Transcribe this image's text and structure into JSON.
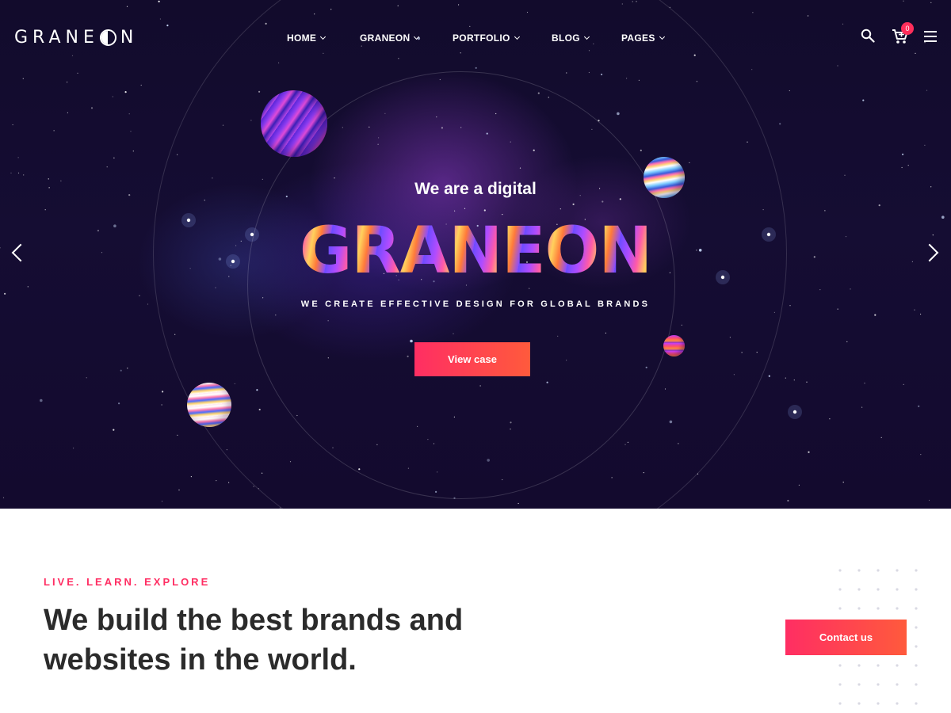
{
  "header": {
    "logo_before": "GRANE",
    "logo_after": "N",
    "nav": [
      {
        "label": "HOME"
      },
      {
        "label": "GRANEON"
      },
      {
        "label": "PORTFOLIO"
      },
      {
        "label": "BLOG"
      },
      {
        "label": "PAGES"
      }
    ],
    "cart_count": "0",
    "icons": [
      "search-icon",
      "cart-icon",
      "menu-icon",
      "chevron-down-icon"
    ]
  },
  "hero": {
    "kicker": "We are a digital",
    "title": "GRANEON",
    "subtitle": "WE CREATE EFFECTIVE DESIGN FOR GLOBAL BRANDS",
    "cta_label": "View case",
    "icons": [
      "chevron-left-icon",
      "chevron-right-icon"
    ]
  },
  "intro": {
    "eyebrow": "LIVE. LEARN. EXPLORE",
    "headline_line1": "We build the best brands and",
    "headline_line2": "websites in the world.",
    "cta_label": "Contact us"
  },
  "colors": {
    "accent": "#ff2e63",
    "accent_end": "#ff5a3c",
    "hero_bg": "#150d33",
    "headline_text": "#2b2b2b"
  }
}
